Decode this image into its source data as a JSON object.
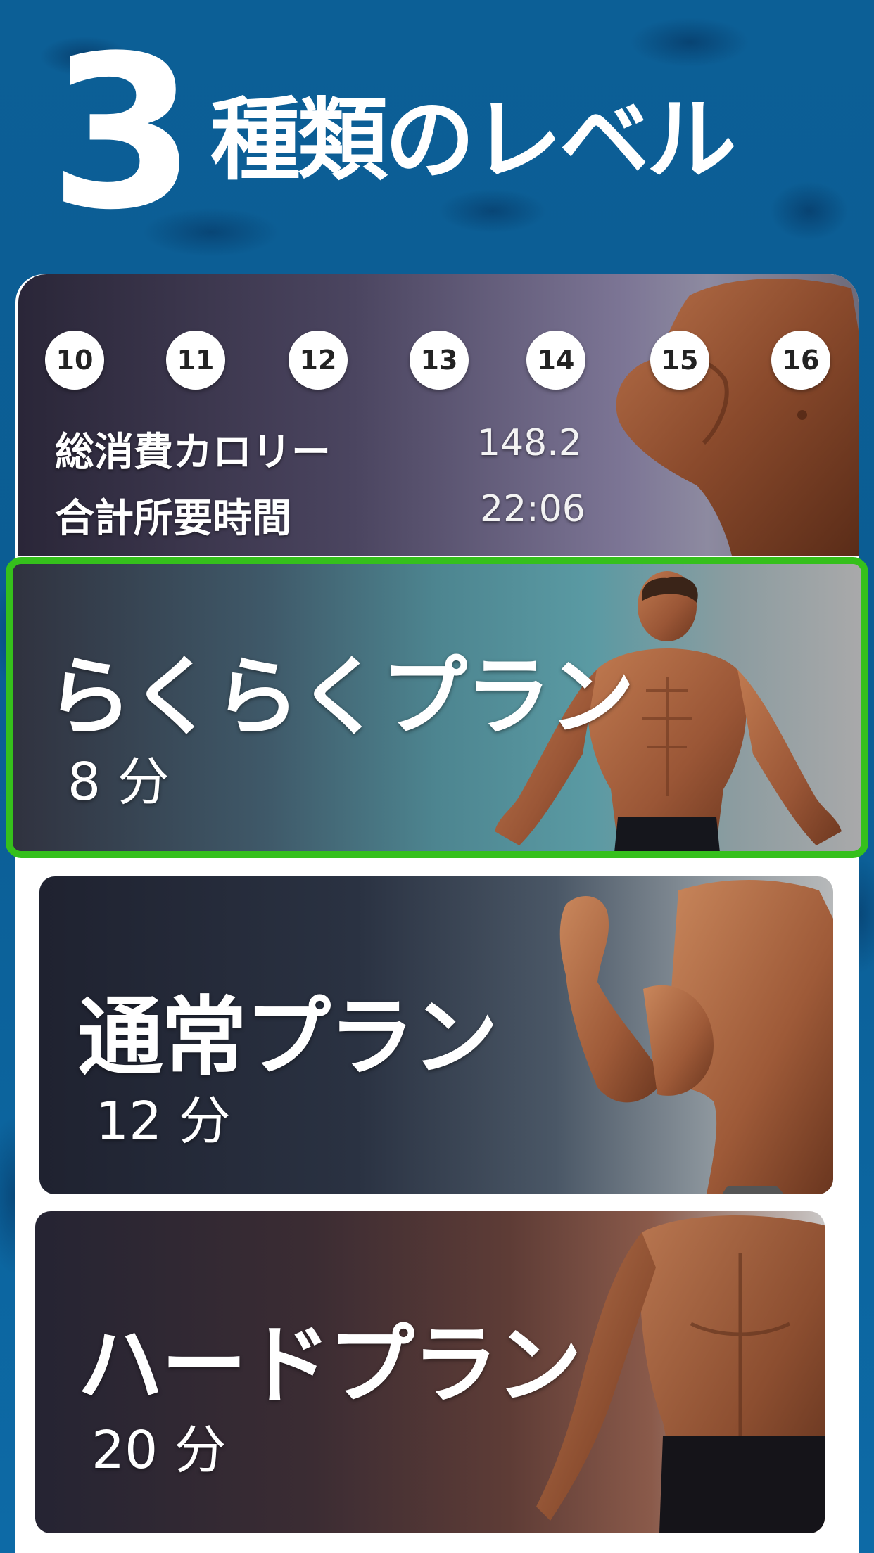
{
  "header": {
    "number": "3",
    "title": "種類のレベル"
  },
  "stats_card": {
    "days": [
      "10",
      "11",
      "12",
      "13",
      "14",
      "15",
      "16"
    ],
    "calories_label": "総消費カロリー",
    "calories_value": "148.2",
    "time_label": "合計所要時間",
    "time_value": "22:06"
  },
  "plans": [
    {
      "name": "らくらくプラン",
      "duration": "8 分",
      "selected": true
    },
    {
      "name": "通常プラン",
      "duration": "12 分",
      "selected": false
    },
    {
      "name": "ハードプラン",
      "duration": "20 分",
      "selected": false
    }
  ],
  "colors": {
    "background": "#0b5d94",
    "selected_border": "#35c01c",
    "panel": "#ffffff"
  }
}
